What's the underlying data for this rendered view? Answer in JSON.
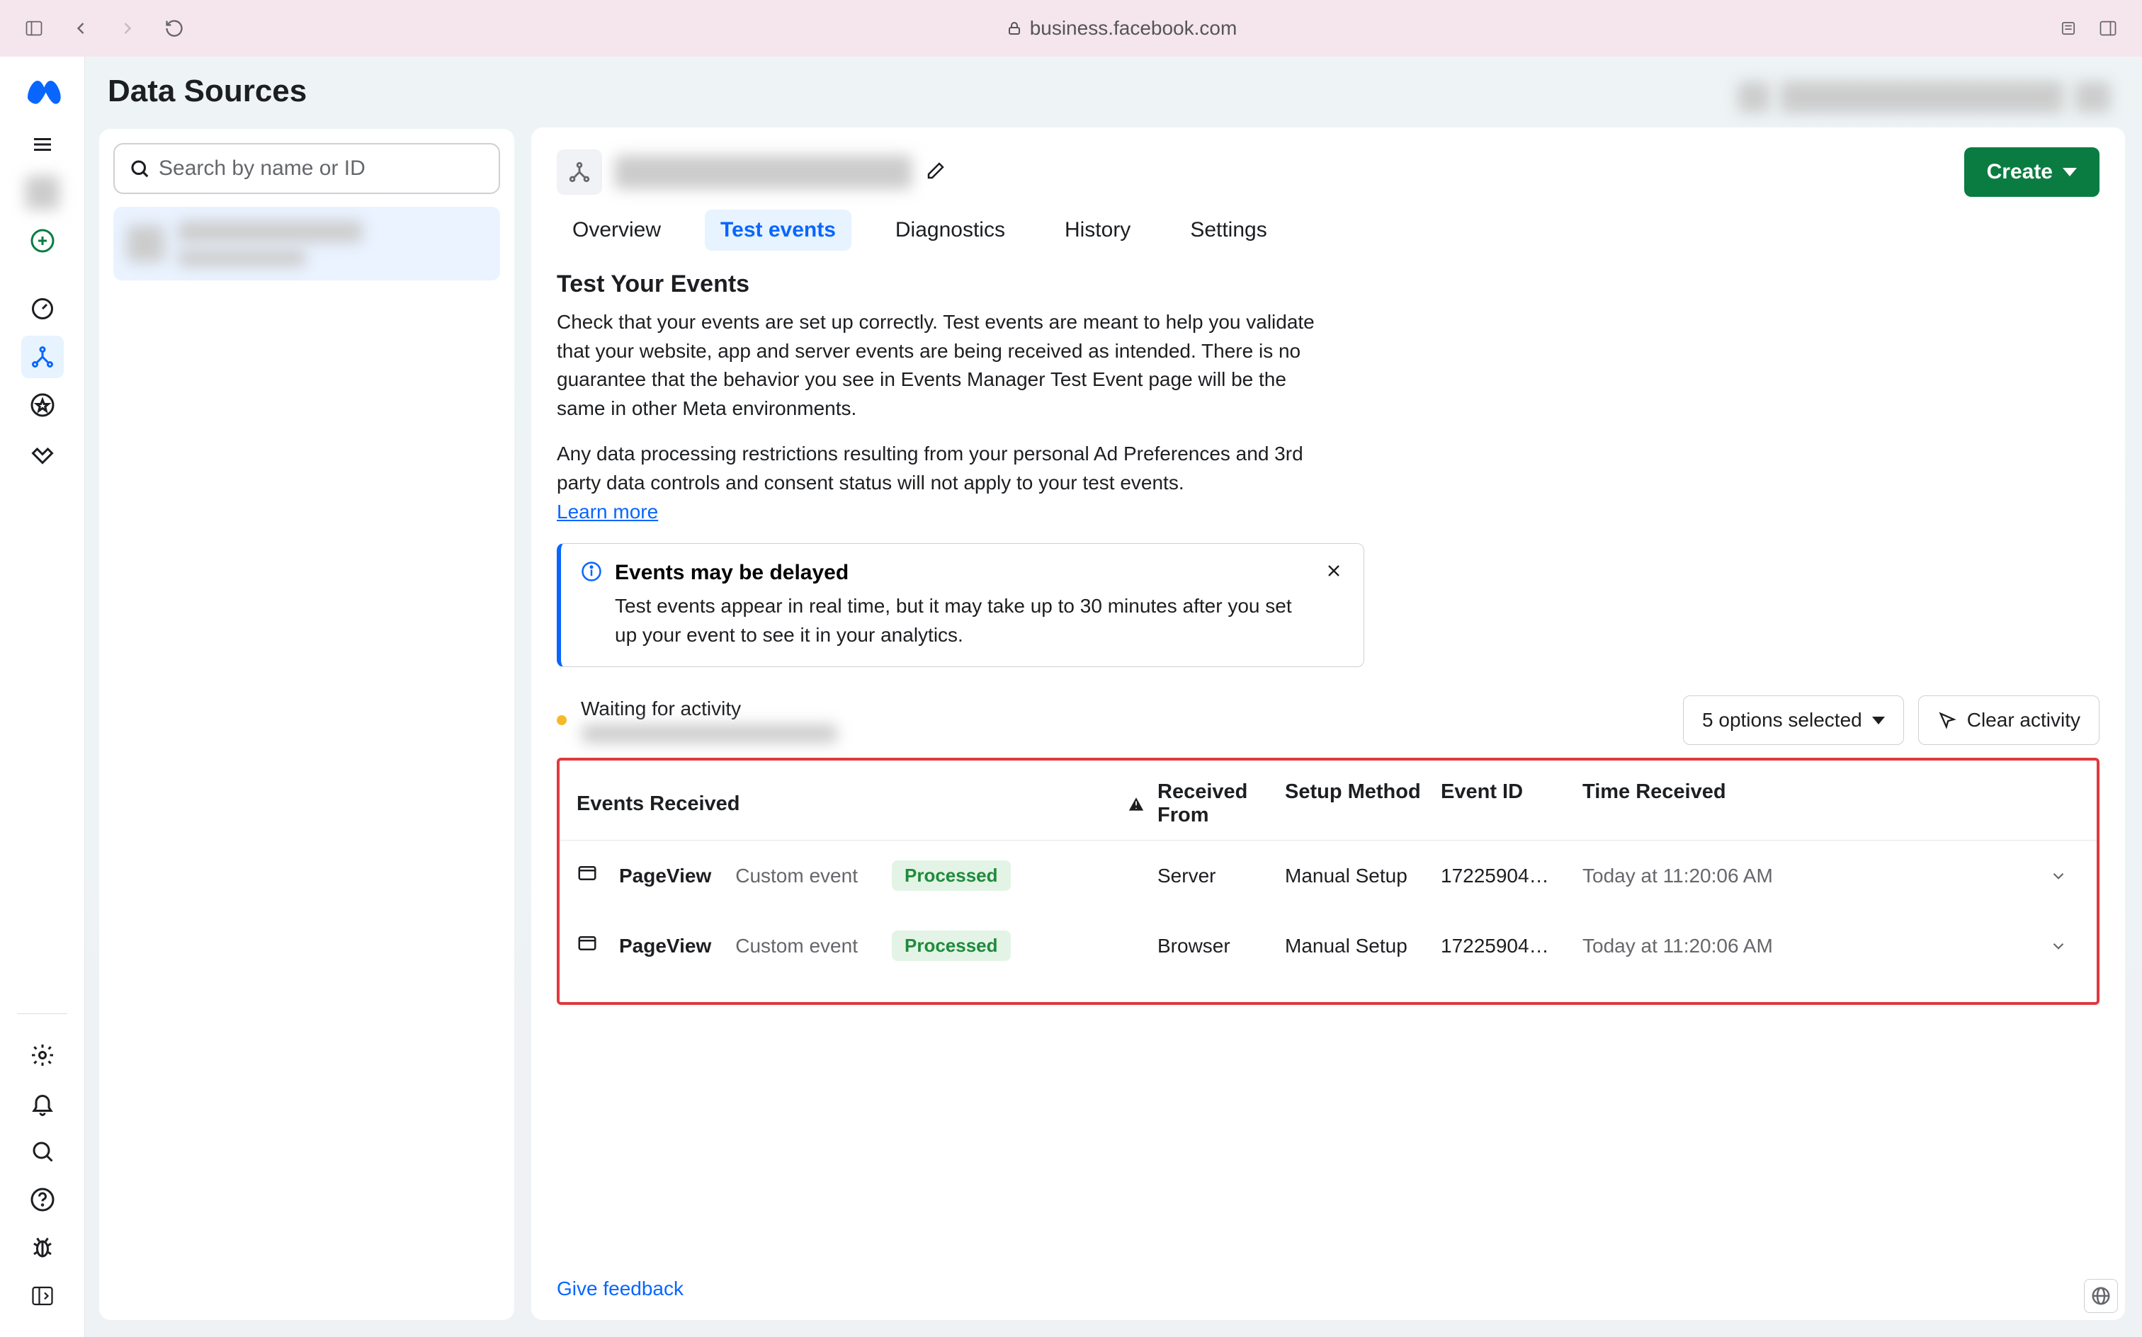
{
  "browser": {
    "url": "business.facebook.com"
  },
  "page": {
    "title": "Data Sources"
  },
  "search": {
    "placeholder": "Search by name or ID"
  },
  "tabs": {
    "overview": "Overview",
    "test_events": "Test events",
    "diagnostics": "Diagnostics",
    "history": "History",
    "settings": "Settings"
  },
  "create_button": "Create",
  "section": {
    "title": "Test Your Events",
    "body1": "Check that your events are set up correctly. Test events are meant to help you validate that your website, app and server events are being received as intended. There is no guarantee that the behavior you see in Events Manager Test Event page will be the same in other Meta environments.",
    "body2": "Any data processing restrictions resulting from your personal Ad Preferences and 3rd party data controls and consent status will not apply to your test events.",
    "learn_more": "Learn more"
  },
  "banner": {
    "title": "Events may be delayed",
    "text": "Test events appear in real time, but it may take up to 30 minutes after you set up your event to see it in your analytics."
  },
  "activity": {
    "status": "Waiting for activity",
    "options_selected": "5 options selected",
    "clear": "Clear activity"
  },
  "table": {
    "headers": {
      "events": "Events Received",
      "from": "Received From",
      "setup": "Setup Method",
      "eid": "Event ID",
      "time": "Time Received"
    },
    "rows": [
      {
        "name": "PageView",
        "type": "Custom event",
        "status": "Processed",
        "from": "Server",
        "setup": "Manual Setup",
        "eid": "17225904…",
        "time": "Today at 11:20:06 AM"
      },
      {
        "name": "PageView",
        "type": "Custom event",
        "status": "Processed",
        "from": "Browser",
        "setup": "Manual Setup",
        "eid": "17225904…",
        "time": "Today at 11:20:06 AM"
      }
    ]
  },
  "feedback": "Give feedback"
}
